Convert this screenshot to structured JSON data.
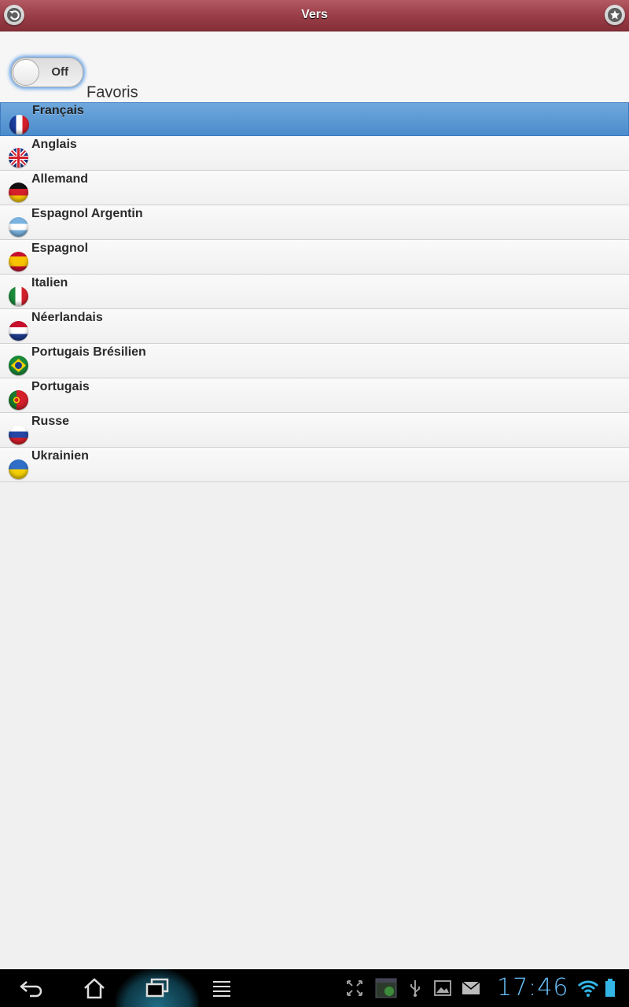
{
  "header": {
    "title": "Vers",
    "left_icon": "back-icon",
    "right_icon": "favorite-star-icon",
    "color": "#9a3e48"
  },
  "favorites_toggle": {
    "state_label": "Off",
    "label": "Favoris",
    "enabled": false
  },
  "languages": [
    {
      "label": "Français",
      "flag": "france-flag-icon",
      "selected": true
    },
    {
      "label": "Anglais",
      "flag": "uk-flag-icon",
      "selected": false
    },
    {
      "label": "Allemand",
      "flag": "germany-flag-icon",
      "selected": false
    },
    {
      "label": "Espagnol Argentin",
      "flag": "argentina-flag-icon",
      "selected": false
    },
    {
      "label": "Espagnol",
      "flag": "spain-flag-icon",
      "selected": false
    },
    {
      "label": "Italien",
      "flag": "italy-flag-icon",
      "selected": false
    },
    {
      "label": "Néerlandais",
      "flag": "netherlands-flag-icon",
      "selected": false
    },
    {
      "label": "Portugais Brésilien",
      "flag": "brazil-flag-icon",
      "selected": false
    },
    {
      "label": "Portugais",
      "flag": "portugal-flag-icon",
      "selected": false
    },
    {
      "label": "Russe",
      "flag": "russia-flag-icon",
      "selected": false
    },
    {
      "label": "Ukrainien",
      "flag": "ukraine-flag-icon",
      "selected": false
    }
  ],
  "statusbar": {
    "time": "17:46",
    "time_color": "#6ac3ff"
  },
  "selected_color": "#4b8ccc"
}
